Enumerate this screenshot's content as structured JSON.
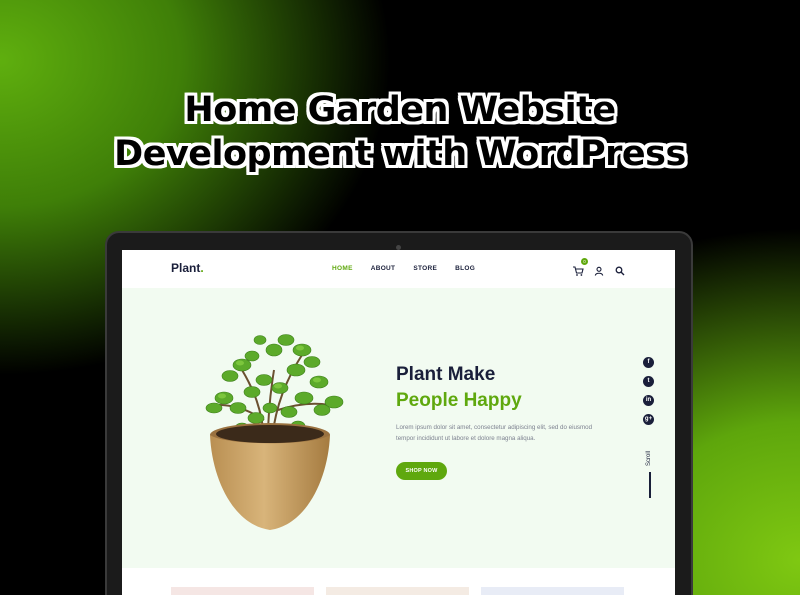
{
  "headline": {
    "line1": "Home Garden Website",
    "line2": "Development with WordPress"
  },
  "site": {
    "logo": "Plant",
    "logo_dot": ".",
    "nav": [
      {
        "label": "HOME",
        "active": true
      },
      {
        "label": "ABOUT",
        "active": false
      },
      {
        "label": "STORE",
        "active": false
      },
      {
        "label": "BLOG",
        "active": false
      }
    ],
    "cart_count": "0",
    "icons": [
      "cart-icon",
      "user-icon",
      "search-icon"
    ]
  },
  "hero": {
    "title_line1": "Plant Make",
    "title_line2": "People Happy",
    "description": "Lorem ipsum dolor sit amet, consectetur adipiscing elit, sed do eiusmod tempor incididunt ut labore et dolore magna aliqua.",
    "button": "SHOP NOW"
  },
  "social": {
    "facebook": "f",
    "twitter": "t",
    "linkedin": "in",
    "googleplus": "g+",
    "scroll_label": "Scroll"
  },
  "colors": {
    "accent": "#5fa80e",
    "navy": "#1a1f3a",
    "hero_bg": "#f2fbf1"
  }
}
